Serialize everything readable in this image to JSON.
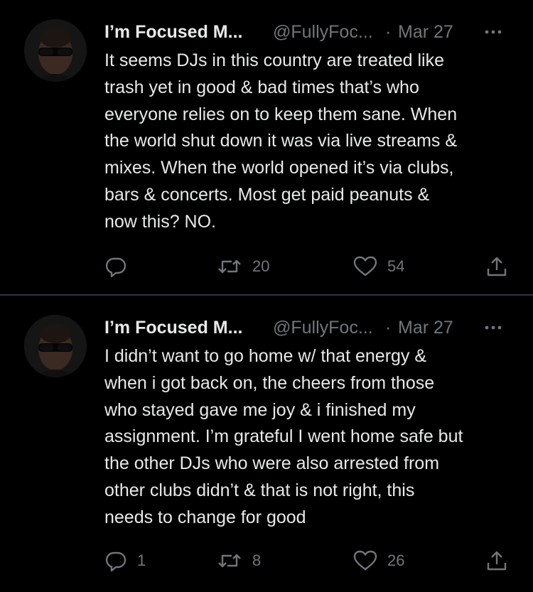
{
  "tweets": [
    {
      "author_name": "I’m Focused M...",
      "handle": "@FullyFoc...",
      "separator": "·",
      "date": "Mar 27",
      "text": "It seems DJs in this country are treated like\ntrash yet in good & bad times that’s who\neveryone relies on to keep them sane. When\nthe world shut down it was via live streams &\nmixes. When the world opened it’s via clubs,\nbars & concerts. Most get paid peanuts &\nnow this? NO.",
      "replies": "",
      "retweets": "20",
      "likes": "54"
    },
    {
      "author_name": "I’m Focused M...",
      "handle": "@FullyFoc...",
      "separator": "·",
      "date": "Mar 27",
      "text": "I didn’t want to go home w/ that energy &\nwhen i got back on, the cheers from those\nwho stayed gave me joy & i finished my\nassignment. I’m grateful I went home safe but\nthe other DJs who were also arrested from\nother clubs didn’t & that is not right, this\nneeds to change for good",
      "replies": "1",
      "retweets": "8",
      "likes": "26"
    }
  ],
  "icons": {
    "avatar": "avatar-photo",
    "more": "more-dots-icon",
    "reply": "reply-bubble-icon",
    "retweet": "retweet-arrows-icon",
    "like": "heart-icon",
    "share": "share-upload-icon"
  },
  "colors": {
    "background": "#000000",
    "text": "#e7e9ea",
    "muted": "#71767b",
    "divider": "#2f3336"
  }
}
